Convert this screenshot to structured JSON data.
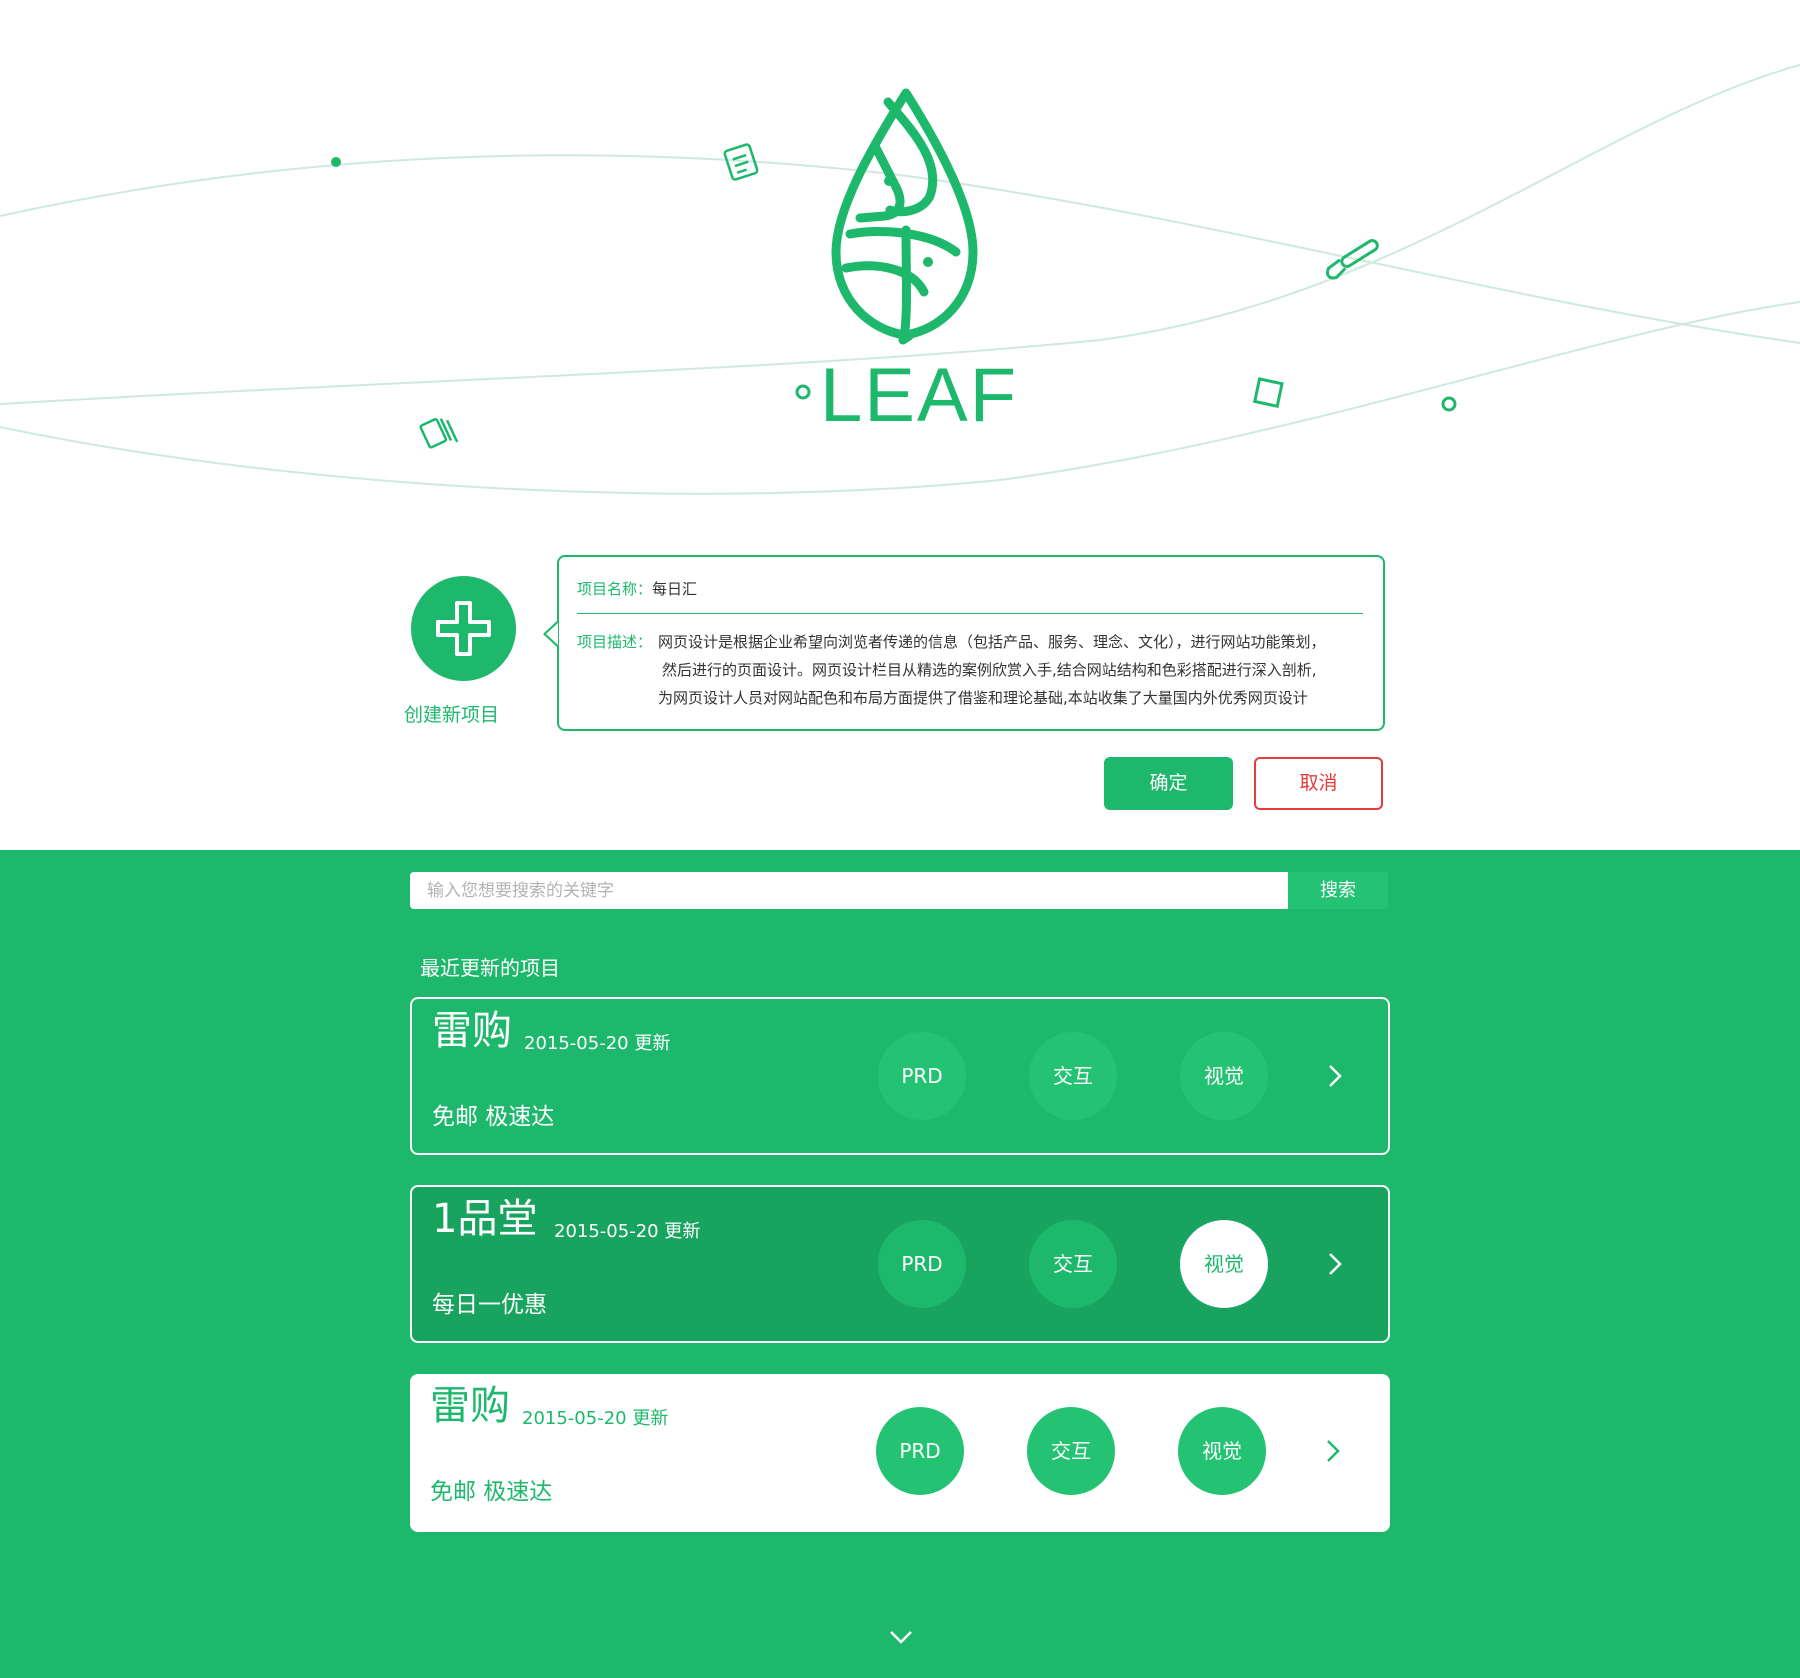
{
  "brand": {
    "name": "LEAF"
  },
  "create": {
    "label": "创建新项目"
  },
  "form": {
    "name_label": "项目名称：",
    "name_value": "每日汇",
    "desc_label": "项目描述：",
    "desc_lines": [
      "网页设计是根据企业希望向浏览者传递的信息（包括产品、服务、理念、文化），进行网站功能策划，",
      "然后进行的页面设计。网页设计栏目从精选的案例欣赏入手,结合网站结构和色彩搭配进行深入剖析,",
      "为网页设计人员对网站配色和布局方面提供了借鉴和理论基础,本站收集了大量国内外优秀网页设计"
    ],
    "confirm_label": "确定",
    "cancel_label": "取消"
  },
  "search": {
    "placeholder": "输入您想要搜索的关键字",
    "button_label": "搜索"
  },
  "recent": {
    "title": "最近更新的项目",
    "items": [
      {
        "name": "雷购",
        "date": "2015-05-20 更新",
        "tagline": "免邮 极速达",
        "buttons": [
          "PRD",
          "交互",
          "视觉"
        ],
        "style": "outline",
        "selected": ""
      },
      {
        "name": "1品堂",
        "date": "2015-05-20 更新",
        "tagline": "每日一优惠",
        "buttons": [
          "PRD",
          "交互",
          "视觉"
        ],
        "style": "active",
        "selected": "视觉"
      },
      {
        "name": "雷购",
        "date": "2015-05-20 更新",
        "tagline": "免邮 极速达",
        "buttons": [
          "PRD",
          "交互",
          "视觉"
        ],
        "style": "white",
        "selected": ""
      }
    ]
  },
  "colors": {
    "primary": "#1eb86d",
    "primary_light": "#24c374",
    "primary_dark": "#18a35f",
    "danger": "#e43b3b",
    "wave": "#cfe9e2"
  },
  "icons": [
    "leaf-logo-icon",
    "document-icon",
    "paintbrush-icon",
    "layers-icon",
    "plus-icon",
    "chevron-right-icon",
    "chevron-down-icon"
  ]
}
